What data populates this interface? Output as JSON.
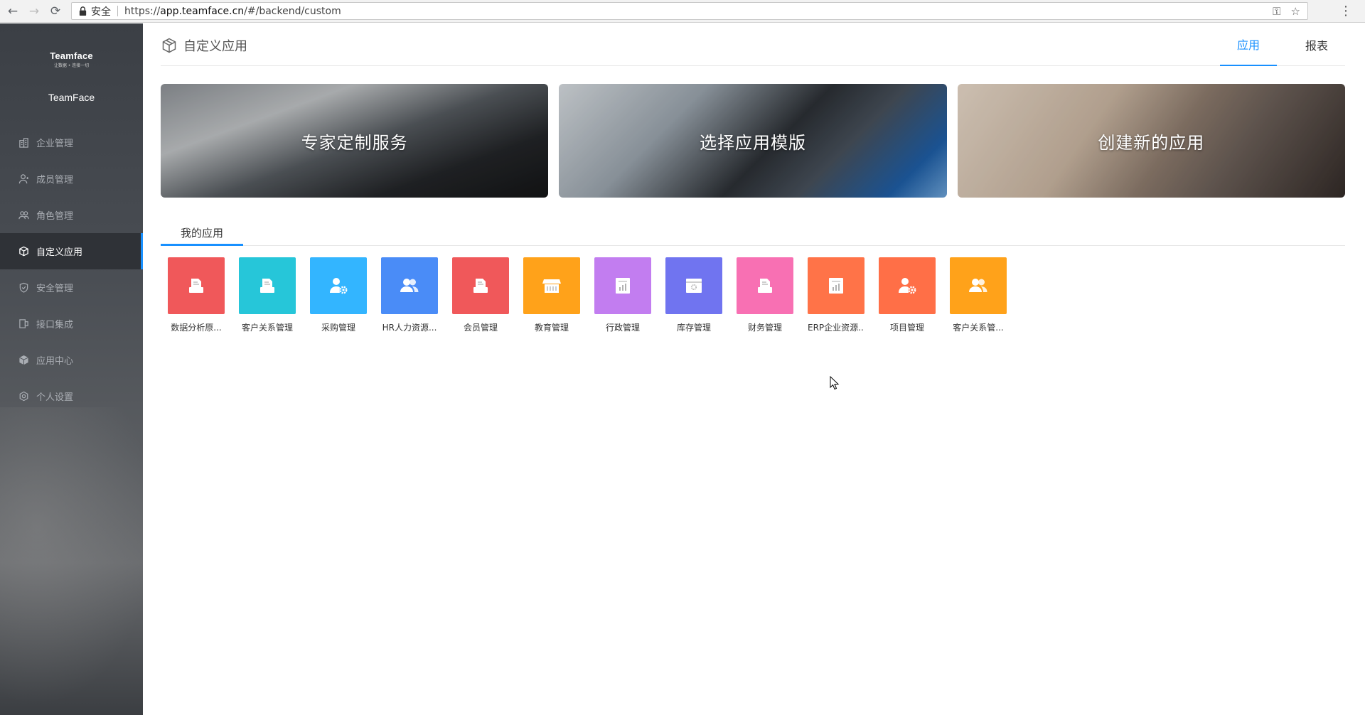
{
  "browser": {
    "secure_label": "安全",
    "url_scheme": "https://",
    "url_host": "app.teamface.cn",
    "url_path": "/#/backend/custom"
  },
  "sidebar": {
    "logo_main": "Teamface",
    "logo_sub": "让数据 • 连接一切",
    "company": "TeamFace",
    "items": [
      {
        "label": "企业管理",
        "icon": "building-icon"
      },
      {
        "label": "成员管理",
        "icon": "member-icon"
      },
      {
        "label": "角色管理",
        "icon": "role-icon"
      },
      {
        "label": "自定义应用",
        "icon": "cube-icon",
        "active": true
      },
      {
        "label": "安全管理",
        "icon": "shield-icon"
      },
      {
        "label": "接口集成",
        "icon": "plug-icon"
      },
      {
        "label": "应用中心",
        "icon": "app-center-icon"
      },
      {
        "label": "个人设置",
        "icon": "settings-icon"
      }
    ]
  },
  "header": {
    "title": "自定义应用",
    "tabs": [
      {
        "label": "应用",
        "active": true
      },
      {
        "label": "报表",
        "active": false
      }
    ]
  },
  "banners": [
    {
      "label": "专家定制服务"
    },
    {
      "label": "选择应用模版"
    },
    {
      "label": "创建新的应用"
    }
  ],
  "section_tab": "我的应用",
  "apps": [
    {
      "name": "数据分析原...",
      "color": "#f0585a",
      "icon": "document-icon"
    },
    {
      "name": "客户关系管理",
      "color": "#26c6d9",
      "icon": "document-icon"
    },
    {
      "name": "采购管理",
      "color": "#33b5ff",
      "icon": "user-settings-icon"
    },
    {
      "name": "HR人力资源...",
      "color": "#4a8cf7",
      "icon": "users-icon"
    },
    {
      "name": "会员管理",
      "color": "#f0585a",
      "icon": "document-icon"
    },
    {
      "name": "教育管理",
      "color": "#ffa21a",
      "icon": "store-icon"
    },
    {
      "name": "行政管理",
      "color": "#c27df0",
      "icon": "report-icon"
    },
    {
      "name": "库存管理",
      "color": "#7074f0",
      "icon": "package-icon"
    },
    {
      "name": "财务管理",
      "color": "#f870b3",
      "icon": "document-icon"
    },
    {
      "name": "ERP企业资源...",
      "color": "#ff7348",
      "icon": "report-icon"
    },
    {
      "name": "项目管理",
      "color": "#ff6f47",
      "icon": "user-settings-icon"
    },
    {
      "name": "客户关系管...",
      "color": "#ffa21a",
      "icon": "users-icon"
    }
  ]
}
